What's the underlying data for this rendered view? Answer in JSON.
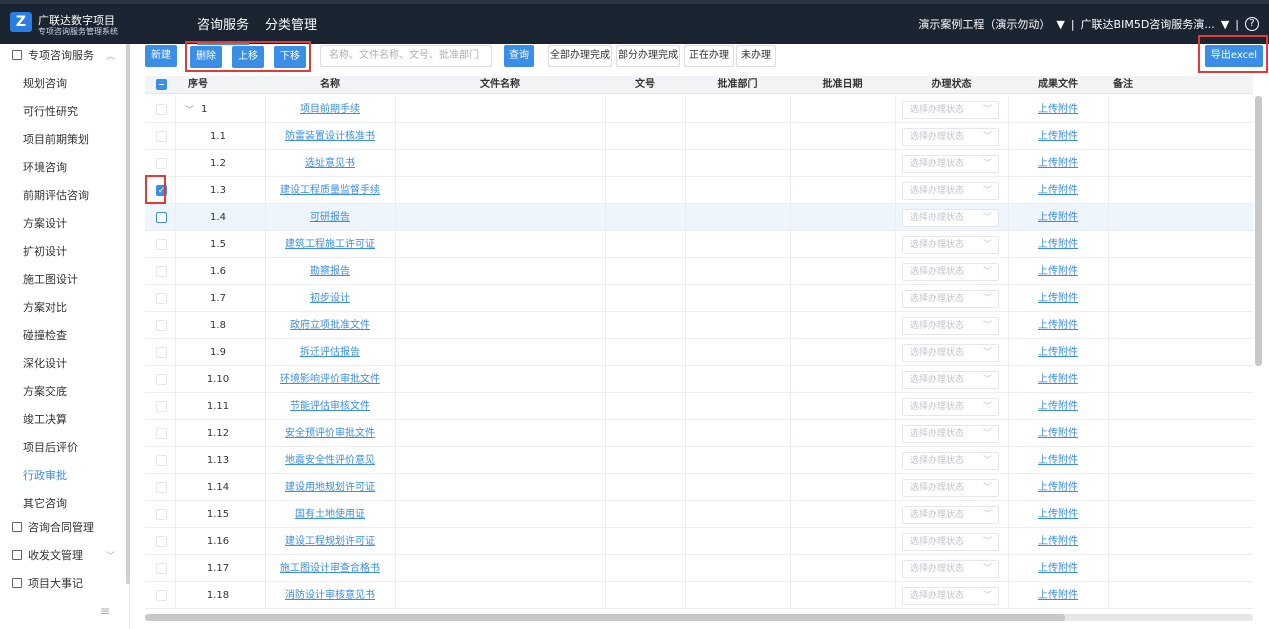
{
  "app": {
    "brand_name": "广联达数字项目",
    "brand_sub": "专项咨询服务管理系统",
    "logo_letter": "Z"
  },
  "topnav": [
    {
      "label": "咨询服务",
      "active": true
    },
    {
      "label": "分类管理",
      "active": false
    }
  ],
  "top_right": {
    "project": "演示案例工程（演示勿动）",
    "org": "广联达BIM5D咨询服务演...",
    "help": "?"
  },
  "sidebar": {
    "groups": [
      {
        "label": "专项咨询服务",
        "expanded": true
      },
      {
        "label": "咨询合同管理"
      },
      {
        "label": "收发文管理"
      },
      {
        "label": "项目大事记"
      }
    ],
    "items": [
      {
        "label": "规划咨询"
      },
      {
        "label": "可行性研究"
      },
      {
        "label": "项目前期策划"
      },
      {
        "label": "环境咨询"
      },
      {
        "label": "前期评估咨询"
      },
      {
        "label": "方案设计"
      },
      {
        "label": "扩初设计"
      },
      {
        "label": "施工图设计"
      },
      {
        "label": "方案对比"
      },
      {
        "label": "碰撞检查"
      },
      {
        "label": "深化设计"
      },
      {
        "label": "方案交底"
      },
      {
        "label": "竣工决算"
      },
      {
        "label": "项目后评价"
      },
      {
        "label": "行政审批",
        "active": true
      },
      {
        "label": "其它咨询"
      }
    ],
    "collapse": "≡"
  },
  "toolbar": {
    "new": "新建",
    "delete": "删除",
    "move_up": "上移",
    "move_down": "下移",
    "search_placeholder": "名称、文件名称、文号、批准部门",
    "query": "查询",
    "filters": [
      "全部办理完成",
      "部分办理完成",
      "正在办理",
      "未办理"
    ],
    "export": "导出excel"
  },
  "table": {
    "columns": [
      "序号",
      "名称",
      "文件名称",
      "文号",
      "批准部门",
      "批准日期",
      "办理状态",
      "成果文件",
      "备注"
    ],
    "status_placeholder": "选择办理状态",
    "upload_label": "上传附件",
    "rows": [
      {
        "no": "1",
        "name": "项目前期手续",
        "parent": true,
        "checked": false
      },
      {
        "no": "1.1",
        "name": "防雷装置设计核准书",
        "checked": false
      },
      {
        "no": "1.2",
        "name": "选址意见书",
        "checked": false
      },
      {
        "no": "1.3",
        "name": "建设工程质量监督手续",
        "checked": true
      },
      {
        "no": "1.4",
        "name": "可研报告",
        "checked": false,
        "highlight": true
      },
      {
        "no": "1.5",
        "name": "建筑工程施工许可证",
        "checked": false
      },
      {
        "no": "1.6",
        "name": "勘察报告",
        "checked": false
      },
      {
        "no": "1.7",
        "name": "初步设计",
        "checked": false
      },
      {
        "no": "1.8",
        "name": "政府立项批准文件",
        "checked": false
      },
      {
        "no": "1.9",
        "name": "拆迁评估报告",
        "checked": false
      },
      {
        "no": "1.10",
        "name": "环境影响评价审批文件",
        "checked": false
      },
      {
        "no": "1.11",
        "name": "节能评估审核文件",
        "checked": false
      },
      {
        "no": "1.12",
        "name": "安全预评价审批文件",
        "checked": false
      },
      {
        "no": "1.13",
        "name": "地震安全性评价意见",
        "checked": false
      },
      {
        "no": "1.14",
        "name": "建设用地规划许可证",
        "checked": false
      },
      {
        "no": "1.15",
        "name": "国有土地使用证",
        "checked": false
      },
      {
        "no": "1.16",
        "name": "建设工程规划许可证",
        "checked": false
      },
      {
        "no": "1.17",
        "name": "施工图设计审查合格书",
        "checked": false
      },
      {
        "no": "1.18",
        "name": "消防设计审核意见书",
        "checked": false
      }
    ]
  },
  "colors": {
    "accent": "#3a8ee6",
    "topbar": "#1b2532",
    "annotation_red": "#e53935"
  }
}
